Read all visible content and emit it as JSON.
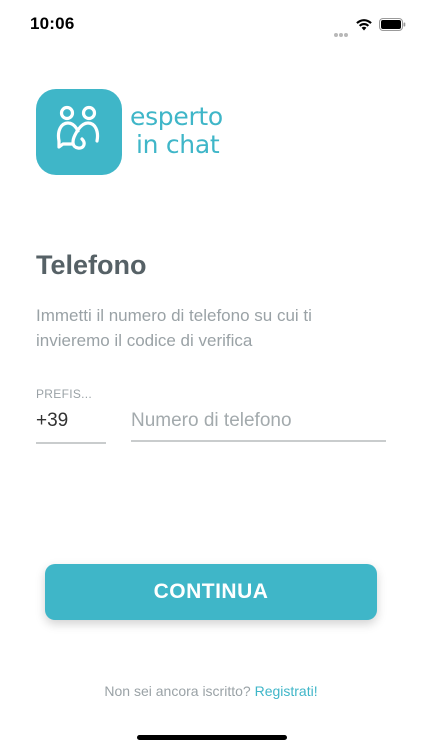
{
  "status_bar": {
    "time": "10:06"
  },
  "logo": {
    "line1": "esperto",
    "line2": "in chat"
  },
  "title": "Telefono",
  "description": "Immetti il numero di telefono su cui ti invieremo il codice di verifica",
  "prefix": {
    "label": "PREFIS...",
    "value": "+39"
  },
  "phone": {
    "placeholder": "Numero di telefono",
    "value": ""
  },
  "continue_label": "CONTINUA",
  "signup": {
    "text": "Non sei ancora iscritto? ",
    "link": "Registrati!"
  },
  "colors": {
    "accent": "#3fb6c8",
    "title": "#566166",
    "muted": "#9aa2a6"
  }
}
